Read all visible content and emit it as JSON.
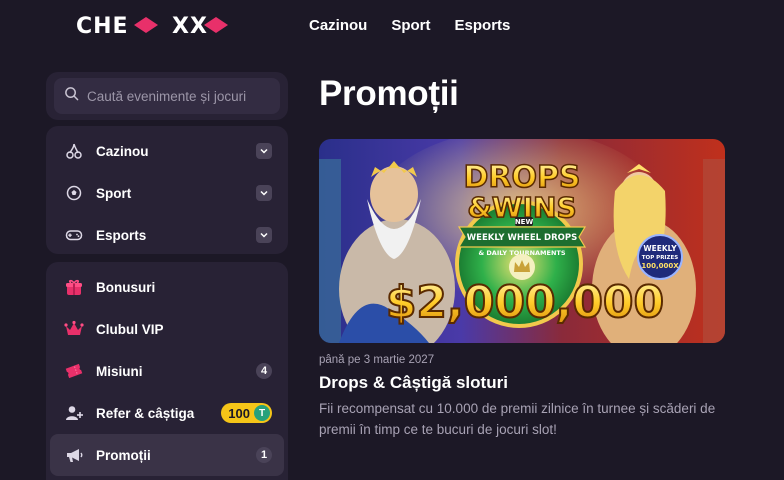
{
  "header": {
    "logo_text": "CHEXX",
    "nav": [
      {
        "label": "Cazinou"
      },
      {
        "label": "Sport"
      },
      {
        "label": "Esports"
      }
    ]
  },
  "search": {
    "placeholder": "Caută evenimente și jocuri"
  },
  "categories": [
    {
      "label": "Cazinou",
      "icon": "cherries-icon"
    },
    {
      "label": "Sport",
      "icon": "soccer-ball-icon"
    },
    {
      "label": "Esports",
      "icon": "gamepad-icon"
    }
  ],
  "menu": [
    {
      "label": "Bonusuri",
      "icon": "gift-icon"
    },
    {
      "label": "Clubul VIP",
      "icon": "crown-icon"
    },
    {
      "label": "Misiuni",
      "icon": "ticket-icon",
      "count": "4"
    },
    {
      "label": "Refer & câștiga",
      "icon": "add-user-icon",
      "badge": "100",
      "badge_coin": "T"
    },
    {
      "label": "Promoții",
      "icon": "megaphone-icon",
      "count": "1",
      "active": true
    }
  ],
  "main": {
    "title": "Promoții",
    "promo": {
      "banner": {
        "line1": "DROPS",
        "amp": "&",
        "line2": "WINS",
        "ribbon_new": "NEW",
        "ribbon_main": "WEEKLY WHEEL DROPS",
        "ribbon_sub": "& DAILY TOURNAMENTS",
        "seal_line1": "WEEKLY",
        "seal_line2": "TOP PRIZES",
        "seal_line3": "100,000X",
        "amount": "$2,000,000"
      },
      "date": "până pe 3 martie 2027",
      "title": "Drops & Câștigă sloturi",
      "description": "Fii recompensat cu 10.000 de premii zilnice în turnee și scăderi de premii în timp ce te bucuri de jocuri slot!"
    }
  },
  "colors": {
    "background": "#1c1826",
    "panel": "#282235",
    "accent_pink": "#e8306a",
    "badge_yellow": "#f5c518",
    "tether_green": "#26a17b"
  }
}
